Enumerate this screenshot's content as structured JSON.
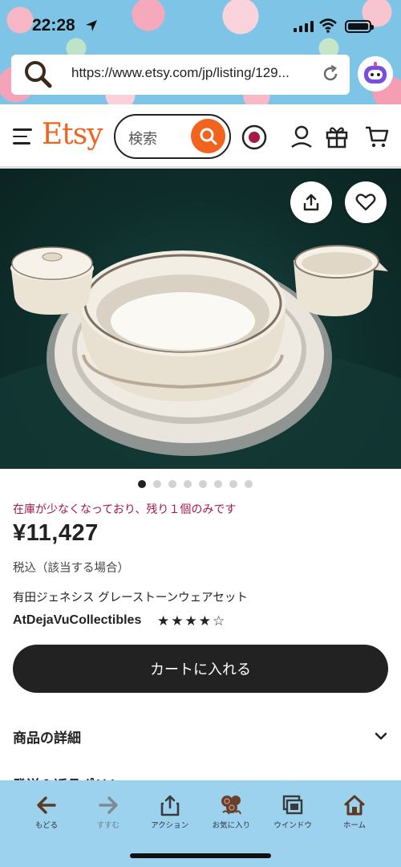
{
  "status_bar": {
    "time": "22:28"
  },
  "browser": {
    "url": "https://www.etsy.com/jp/listing/129..."
  },
  "header": {
    "logo": "Etsy",
    "search_placeholder": "検索"
  },
  "gallery": {
    "image_count": 8,
    "active_index": 0
  },
  "product": {
    "stock_note": "在庫が少なくなっており、残り１個のみです",
    "price": "¥11,427",
    "tax_note": "税込（該当する場合）",
    "title": "有田ジェネシス グレーストーンウェアセット",
    "shop_name": "AtDejaVuCollectibles",
    "rating": 4,
    "rating_max": 5,
    "cart_button": "カートに入れる",
    "details_label": "商品の詳細",
    "next_section_label": "発送＆返品ポリシー"
  },
  "toolbar": {
    "items": [
      {
        "label": "もどる",
        "icon": "back-arrow-icon"
      },
      {
        "label": "すすむ",
        "icon": "forward-arrow-icon"
      },
      {
        "label": "アクション",
        "icon": "share-icon"
      },
      {
        "label": "お気に入り",
        "icon": "rose-bookmark-icon"
      },
      {
        "label": "ウインドウ",
        "icon": "windows-icon"
      },
      {
        "label": "ホーム",
        "icon": "home-icon"
      }
    ]
  },
  "colors": {
    "etsy_orange": "#f1641e",
    "stock_warning": "#a6174a",
    "button_dark": "#222222",
    "toolbar_bg": "#9cd2ee"
  }
}
